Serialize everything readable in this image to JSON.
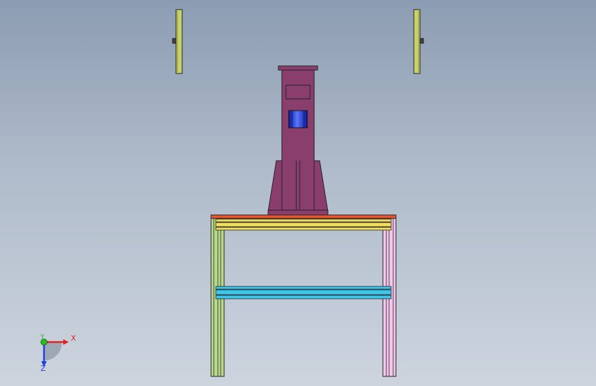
{
  "viewport": {
    "background_top": "#8c9cb2",
    "background_bottom": "#cdd4de"
  },
  "model": {
    "wheel_color": "#c8d26a",
    "column_color": "#8a3e6e",
    "column_window_color": "#2244dd",
    "table_top_color": "#e8552e",
    "upper_rail_color": "#f2de5a",
    "lower_rail_color": "#3cc8ee",
    "left_leg_color": "#b9d98c",
    "right_leg_color": "#f3c6ec",
    "outline_color": "#222222"
  },
  "triad": {
    "x_label": "X",
    "y_label": "Y",
    "z_label": "Z",
    "x_color": "#e02020",
    "y_color": "#20b020",
    "z_color": "#2040e0",
    "icon": "coordinate-triad-icon"
  }
}
